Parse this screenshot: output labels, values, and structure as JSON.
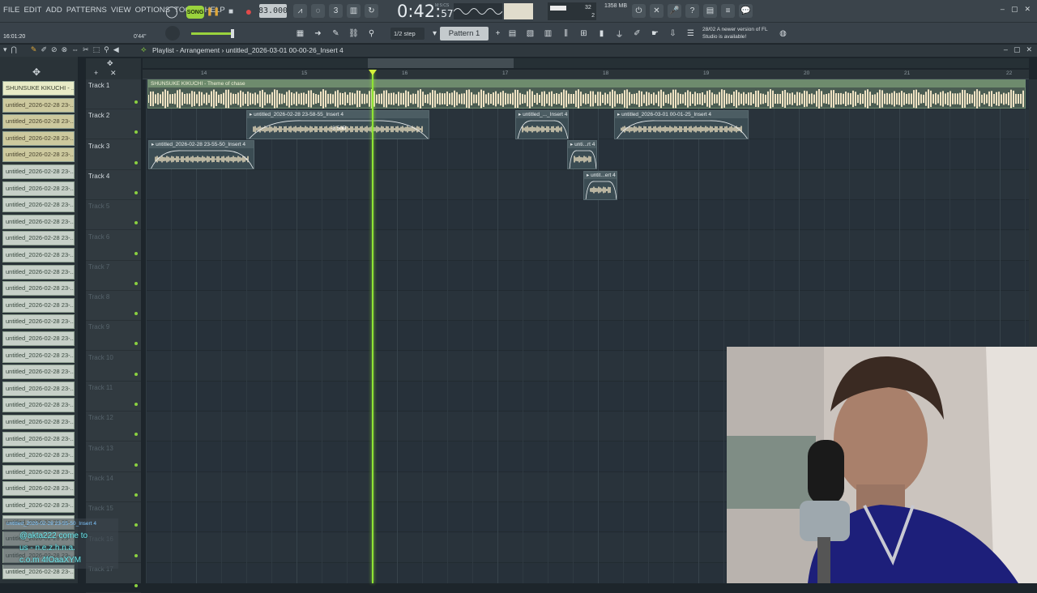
{
  "menu": [
    "FILE",
    "EDIT",
    "ADD",
    "PATTERNS",
    "VIEW",
    "OPTIONS",
    "TOOLS",
    "HELP"
  ],
  "transport": {
    "song_mode": "SONG",
    "tempo": "83.000",
    "time_main": "0:42",
    "time_sub": "57",
    "time_unit": "M:S:CS"
  },
  "cpu": {
    "n1": "32",
    "n2": "2"
  },
  "memory": "1358 MB",
  "hint": {
    "time": "16:01:20",
    "length": "0'44\""
  },
  "toolbar2": {
    "snap": "1/2 step",
    "pattern": "Pattern 1",
    "update_date": "28/02",
    "update_msg": "A newer version of FL Studio is available!"
  },
  "playlist": {
    "title": "Playlist - Arrangement › untitled_2026-03-01 00-00-26_Insert 4",
    "ruler": [
      "14",
      "15",
      "16",
      "17",
      "18",
      "19",
      "20",
      "21",
      "22"
    ],
    "tracks": [
      "Track 1",
      "Track 2",
      "Track 3",
      "Track 4",
      "Track 5",
      "Track 6",
      "Track 7",
      "Track 8",
      "Track 9",
      "Track 10",
      "Track 11",
      "Track 12",
      "Track 13",
      "Track 14",
      "Track 15",
      "Track 16",
      "Track 17"
    ],
    "song_clip_label": "SHUNSUKE KIKUCHI - Theme of chase",
    "clips": [
      {
        "label": "untitled_2026-02-28 23-58-55_Insert 4"
      },
      {
        "label": "untitled_..._Insert 4"
      },
      {
        "label": "untitled_2026-03-01 00-01-25_Insert 4"
      },
      {
        "label": "untitled_2026-02-28 23-55-50_Insert 4"
      },
      {
        "label": "unti...rt 4"
      },
      {
        "label": "untit...ert 4"
      }
    ],
    "gain_label": "-3.5dB"
  },
  "picker": {
    "first": "SHUNSUKE KIKUCHI - ...",
    "item": "untitled_2026-02-28 23-..."
  },
  "chat": {
    "name": "untitled_2026-02-28 23-55-50_Insert 4",
    "message_lines": [
      "@akta222 come to",
      "us - n.e.z.h.n.a.",
      "c.o.m 4fOaaXYM"
    ]
  },
  "colors": {
    "accent_green": "#8fe334",
    "pattern_bg": "#c4cacd",
    "clip_bg": "#3b4c53"
  }
}
